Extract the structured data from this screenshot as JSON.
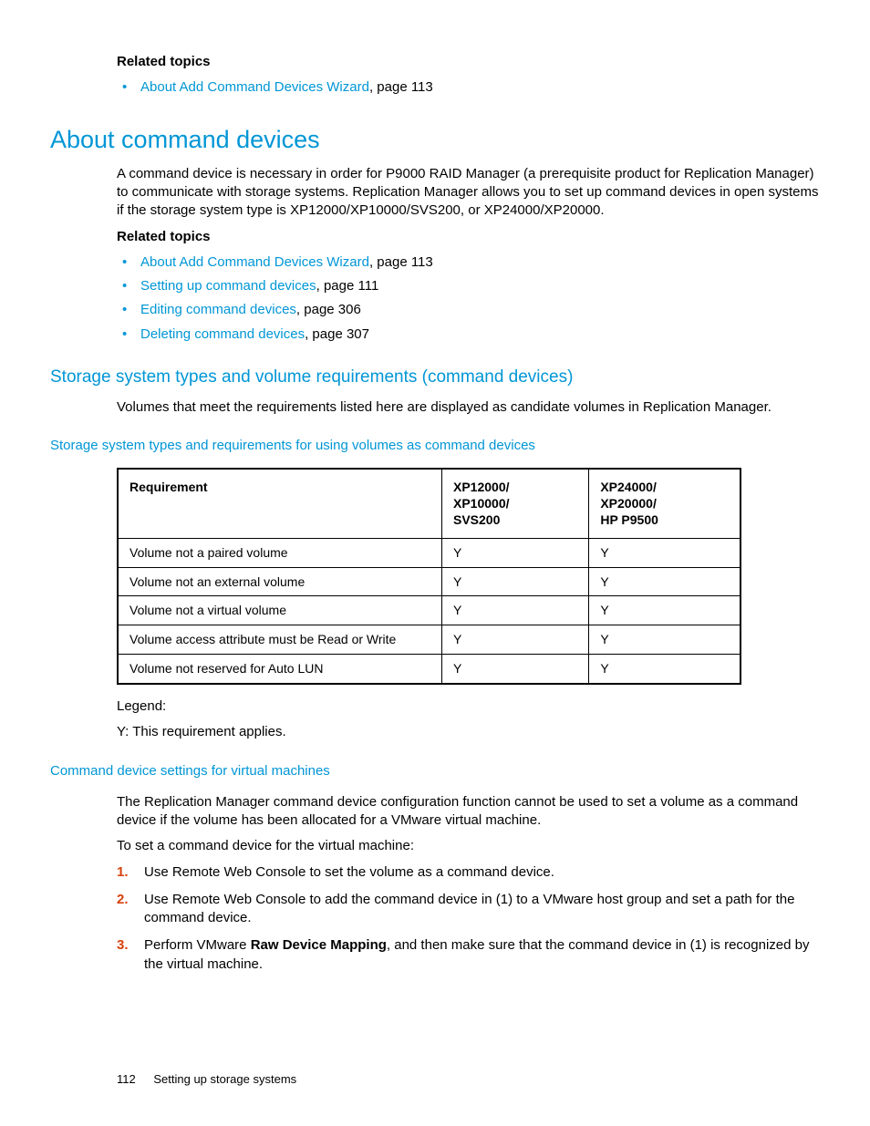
{
  "top_related": {
    "heading": "Related topics",
    "items": [
      {
        "link": "About Add Command Devices Wizard",
        "suffix": ", page 113"
      }
    ]
  },
  "h1": "About command devices",
  "intro": "A command device is necessary in order for P9000 RAID Manager (a prerequisite product for Replication Manager) to communicate with storage systems. Replication Manager allows you to set up command devices in open systems if the storage system type is XP12000/XP10000/SVS200, or XP24000/XP20000.",
  "related2": {
    "heading": "Related topics",
    "items": [
      {
        "link": "About Add Command Devices Wizard",
        "suffix": ", page 113"
      },
      {
        "link": "Setting up command devices",
        "suffix": ", page 111"
      },
      {
        "link": "Editing command devices",
        "suffix": ", page 306"
      },
      {
        "link": "Deleting command devices",
        "suffix": ", page 307"
      }
    ]
  },
  "h2a": "Storage system types and volume requirements (command devices)",
  "para_a": "Volumes that meet the requirements listed here are displayed as candidate volumes in Replication Manager.",
  "table_title": "Storage system types and requirements for using volumes as command devices",
  "table": {
    "headers": [
      "Requirement",
      "XP12000/\nXP10000/\nSVS200",
      "XP24000/\nXP20000/\nHP P9500"
    ],
    "rows": [
      [
        "Volume not a paired volume",
        "Y",
        "Y"
      ],
      [
        "Volume not an external volume",
        "Y",
        "Y"
      ],
      [
        "Volume not a virtual volume",
        "Y",
        "Y"
      ],
      [
        "Volume access attribute must be Read or Write",
        "Y",
        "Y"
      ],
      [
        "Volume not reserved for Auto LUN",
        "Y",
        "Y"
      ]
    ]
  },
  "legend1": "Legend:",
  "legend2": "Y: This requirement applies.",
  "h2b": "Command device settings for virtual machines",
  "para_b1": "The Replication Manager command device configuration function cannot be used to set a volume as a command device if the volume has been allocated for a VMware virtual machine.",
  "para_b2": "To set a command device for the virtual machine:",
  "steps": {
    "s1": "Use Remote Web Console to set the volume as a command device.",
    "s2": "Use Remote Web Console to add the command device in (1) to a VMware host group and set a path for the command device.",
    "s3a": "Perform VMware ",
    "s3b": "Raw Device Mapping",
    "s3c": ", and then make sure that the command device in (1) is recognized by the virtual machine."
  },
  "footer": {
    "page": "112",
    "section": "Setting up storage systems"
  }
}
